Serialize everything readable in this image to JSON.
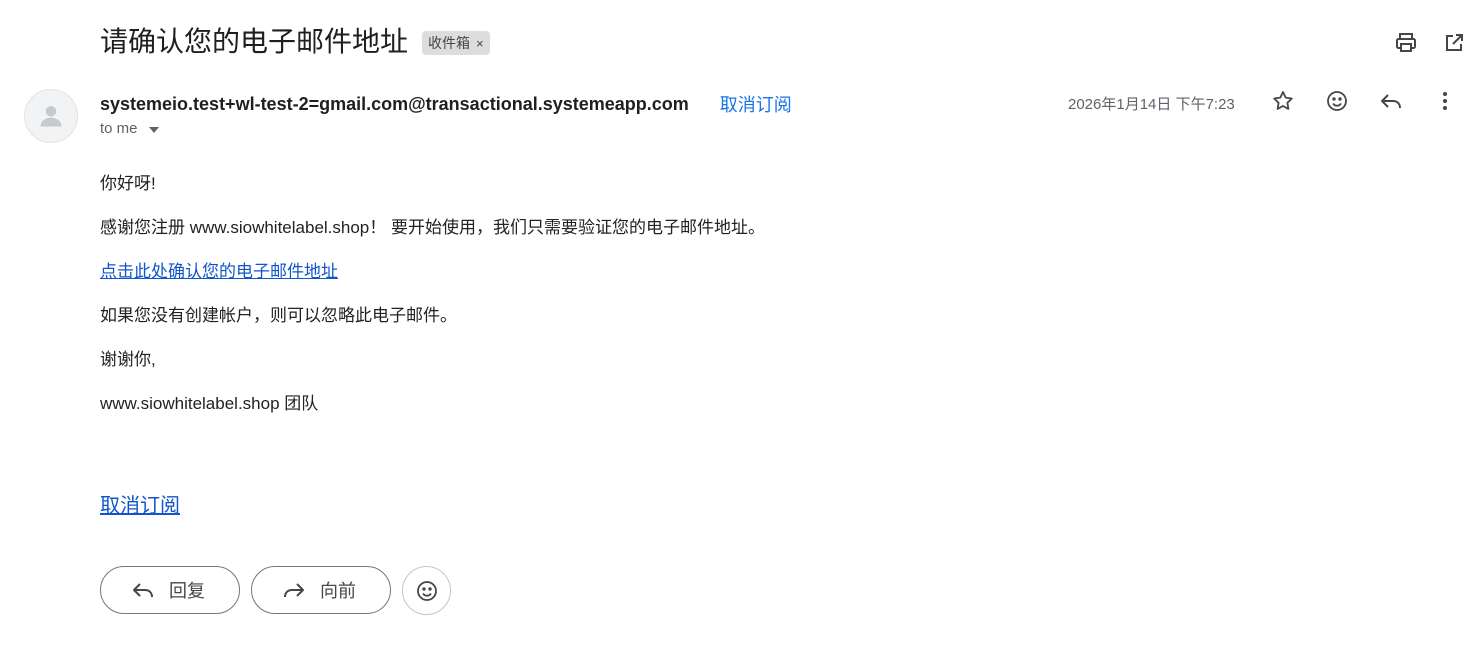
{
  "message": {
    "subject": "请确认您的电子邮件地址",
    "label": "收件箱",
    "label_remove": "×",
    "sender": "systemeio.test+wl-test-2=gmail.com@transactional.systemeapp.com",
    "unsubscribe_header": "取消订阅",
    "to": "to me",
    "date": "2026年1月14日 下午7:23"
  },
  "body": {
    "greeting": "你好呀!",
    "line1": "感谢您注册 www.siowhitelabel.shop！ 要开始使用，我们只需要验证您的电子邮件地址。",
    "confirm_link": "点击此处确认您的电子邮件地址",
    "line2": "如果您没有创建帐户，则可以忽略此电子邮件。",
    "thanks": "谢谢你,",
    "signature": "www.siowhitelabel.shop 团队",
    "unsubscribe_footer": "取消订阅"
  },
  "actions": {
    "reply_label": "回复",
    "forward_label": "向前"
  },
  "icons": {
    "print": "print-icon",
    "open_new": "open-in-new-icon",
    "star": "star-icon",
    "emoji": "emoji-icon",
    "reply": "reply-icon",
    "more": "more-vert-icon",
    "avatar": "person-icon",
    "forward": "forward-icon"
  },
  "colors": {
    "link": "#1155cc",
    "header_link": "#1a73e8",
    "chip_bg": "#dddddd"
  }
}
